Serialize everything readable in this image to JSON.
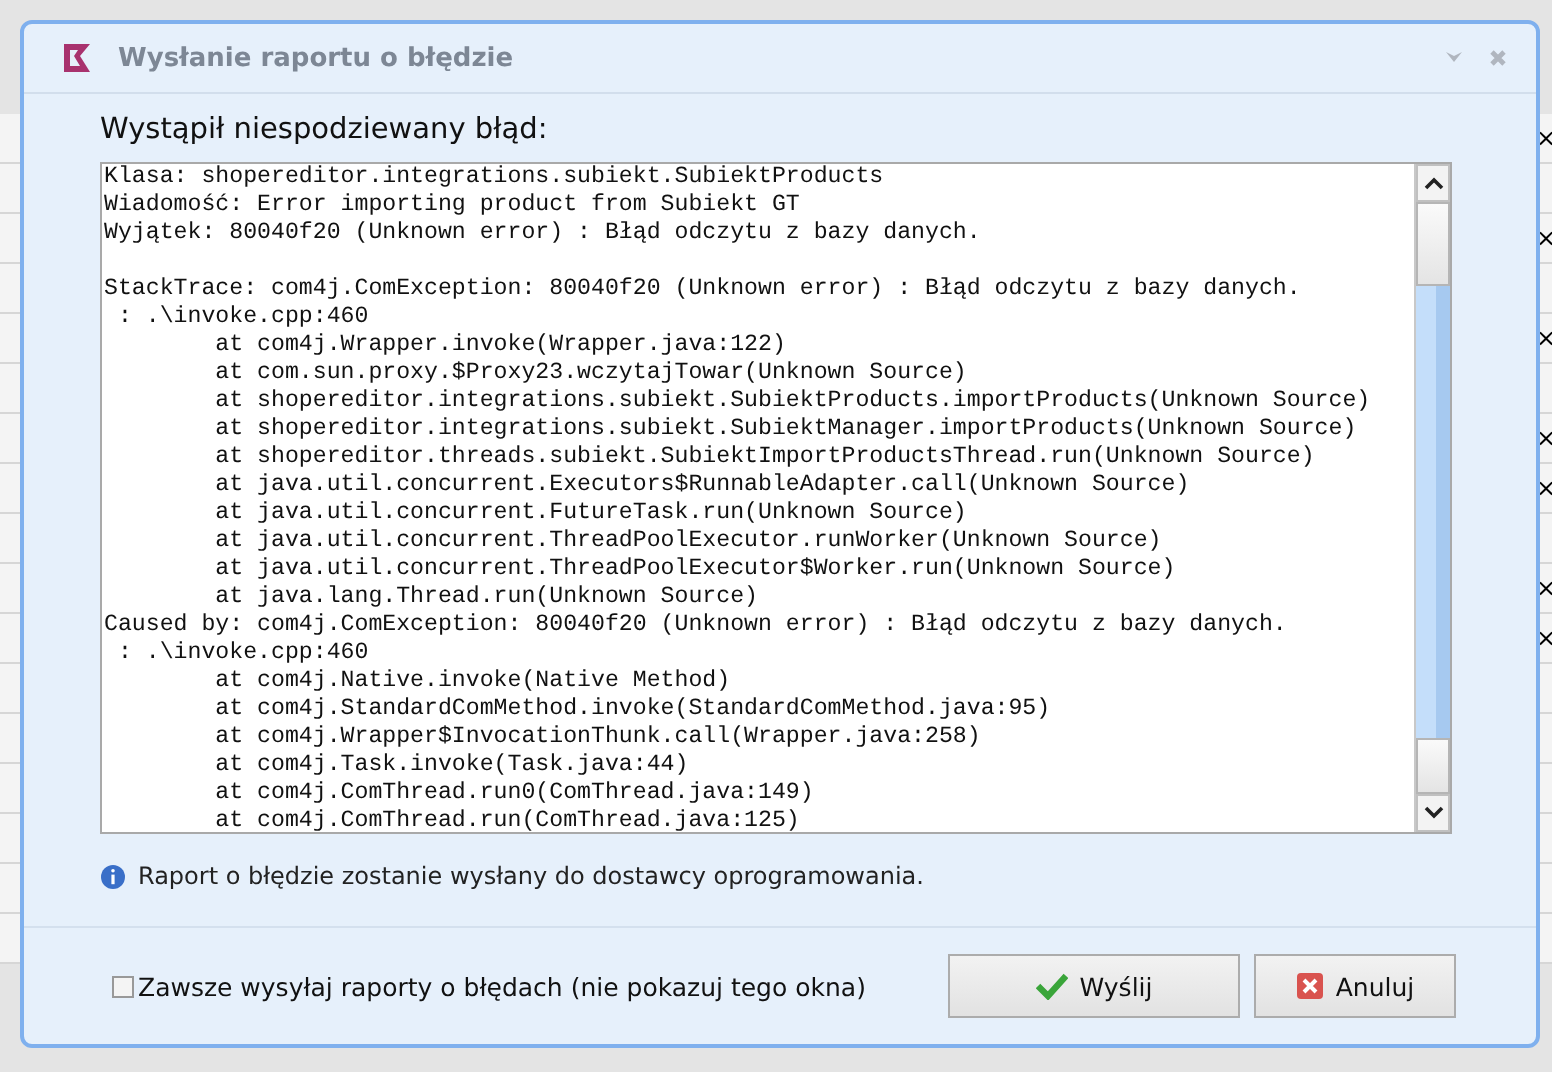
{
  "background": {
    "rows": [
      {
        "mark": "×"
      },
      {},
      {
        "mark": "×"
      },
      {},
      {
        "mark": "×"
      },
      {},
      {
        "mark": "×"
      },
      {
        "mark": "×"
      },
      {},
      {
        "mark": "×"
      },
      {
        "mark": "×"
      },
      {},
      {},
      {},
      {},
      {},
      {}
    ]
  },
  "window": {
    "title": "Wysłanie raportu o błędzie"
  },
  "heading": "Wystąpił niespodziewany błąd:",
  "report_blocks": [
    [
      "Klasa: shopereditor.integrations.subiekt.SubiektProducts",
      "Wiadomość: Error importing product from Subiekt GT",
      "Wyjątek: 80040f20 (Unknown error) : Błąd odczytu z bazy danych."
    ],
    [
      "StackTrace: com4j.ComException: 80040f20 (Unknown error) : Błąd odczytu z bazy danych.",
      " : .\\invoke.cpp:460",
      "        at com4j.Wrapper.invoke(Wrapper.java:122)",
      "        at com.sun.proxy.$Proxy23.wczytajTowar(Unknown Source)",
      "        at shopereditor.integrations.subiekt.SubiektProducts.importProducts(Unknown Source)",
      "        at shopereditor.integrations.subiekt.SubiektManager.importProducts(Unknown Source)",
      "        at shopereditor.threads.subiekt.SubiektImportProductsThread.run(Unknown Source)",
      "        at java.util.concurrent.Executors$RunnableAdapter.call(Unknown Source)",
      "        at java.util.concurrent.FutureTask.run(Unknown Source)",
      "        at java.util.concurrent.ThreadPoolExecutor.runWorker(Unknown Source)",
      "        at java.util.concurrent.ThreadPoolExecutor$Worker.run(Unknown Source)",
      "        at java.lang.Thread.run(Unknown Source)",
      "Caused by: com4j.ComException: 80040f20 (Unknown error) : Błąd odczytu z bazy danych.",
      " : .\\invoke.cpp:460",
      "        at com4j.Native.invoke(Native Method)",
      "        at com4j.StandardComMethod.invoke(StandardComMethod.java:95)",
      "        at com4j.Wrapper$InvocationThunk.call(Wrapper.java:258)",
      "        at com4j.Task.invoke(Task.java:44)",
      "        at com4j.ComThread.run0(ComThread.java:149)",
      "        at com4j.ComThread.run(ComThread.java:125)"
    ]
  ],
  "info": "Raport o błędzie zostanie wysłany do dostawcy oprogramowania.",
  "always_send": {
    "label": "Zawsze wysyłaj raporty o błędach (nie pokazuj tego okna)",
    "checked": false
  },
  "buttons": [
    {
      "kind": "send",
      "label": "Wyślij"
    },
    {
      "kind": "cancel",
      "label": "Anuluj"
    }
  ]
}
